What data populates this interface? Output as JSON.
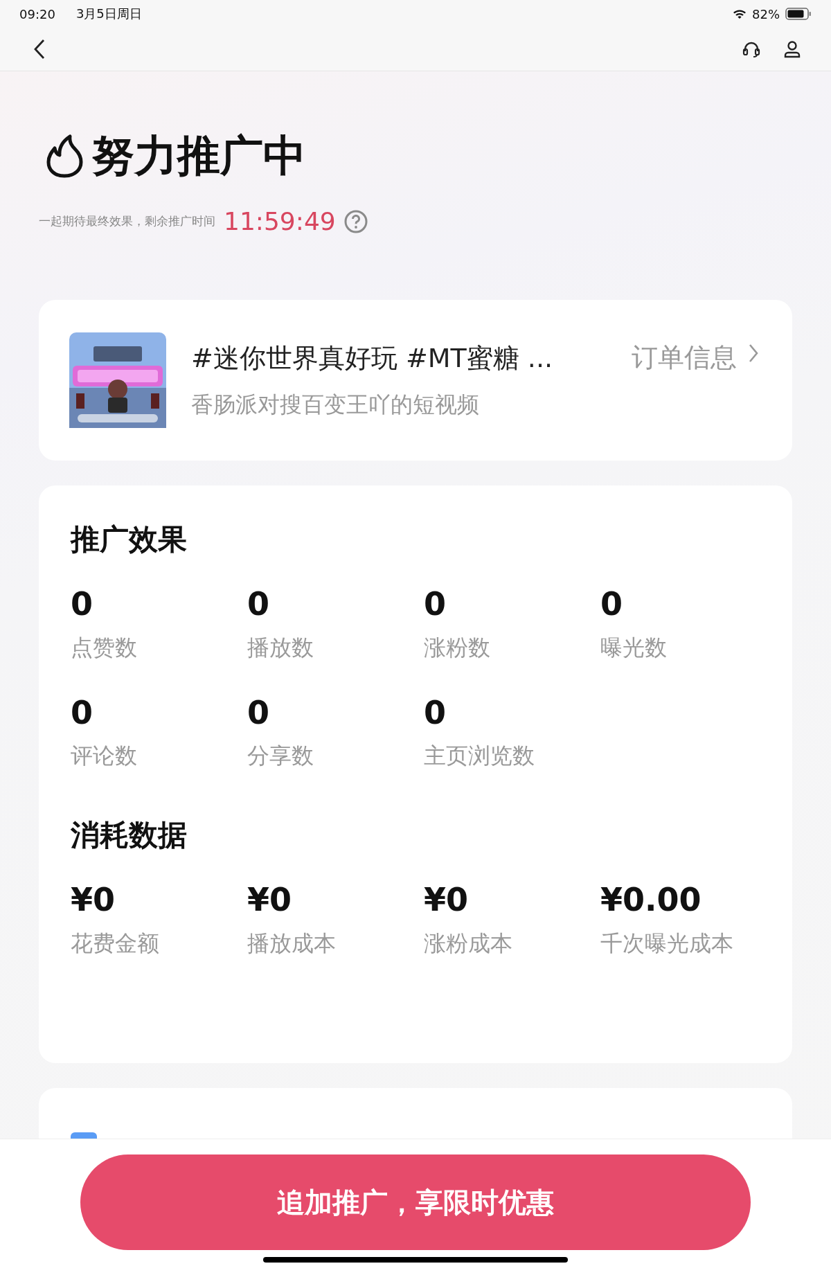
{
  "status_bar": {
    "time": "09:20",
    "date": "3月5日周日",
    "battery": "82%"
  },
  "header": {
    "title": "努力推广中",
    "subtitle": "一起期待最终效果，剩余推广时间",
    "countdown": "11:59:49"
  },
  "order": {
    "title": "#迷你世界真好玩 #MT蜜糖 ...",
    "author": "香肠派对搜百变王吖的短视频",
    "link": "订单信息"
  },
  "effect": {
    "title": "推广效果",
    "stats": [
      {
        "value": "0",
        "label": "点赞数"
      },
      {
        "value": "0",
        "label": "播放数"
      },
      {
        "value": "0",
        "label": "涨粉数"
      },
      {
        "value": "0",
        "label": "曝光数"
      },
      {
        "value": "0",
        "label": "评论数"
      },
      {
        "value": "0",
        "label": "分享数"
      },
      {
        "value": "0",
        "label": "主页浏览数"
      }
    ]
  },
  "spend": {
    "title": "消耗数据",
    "stats": [
      {
        "value": "¥0",
        "label": "花费金额"
      },
      {
        "value": "¥0",
        "label": "播放成本"
      },
      {
        "value": "¥0",
        "label": "涨粉成本"
      },
      {
        "value": "¥0.00",
        "label": "千次曝光成本"
      }
    ]
  },
  "action_button": "追加推广，享限时优惠"
}
